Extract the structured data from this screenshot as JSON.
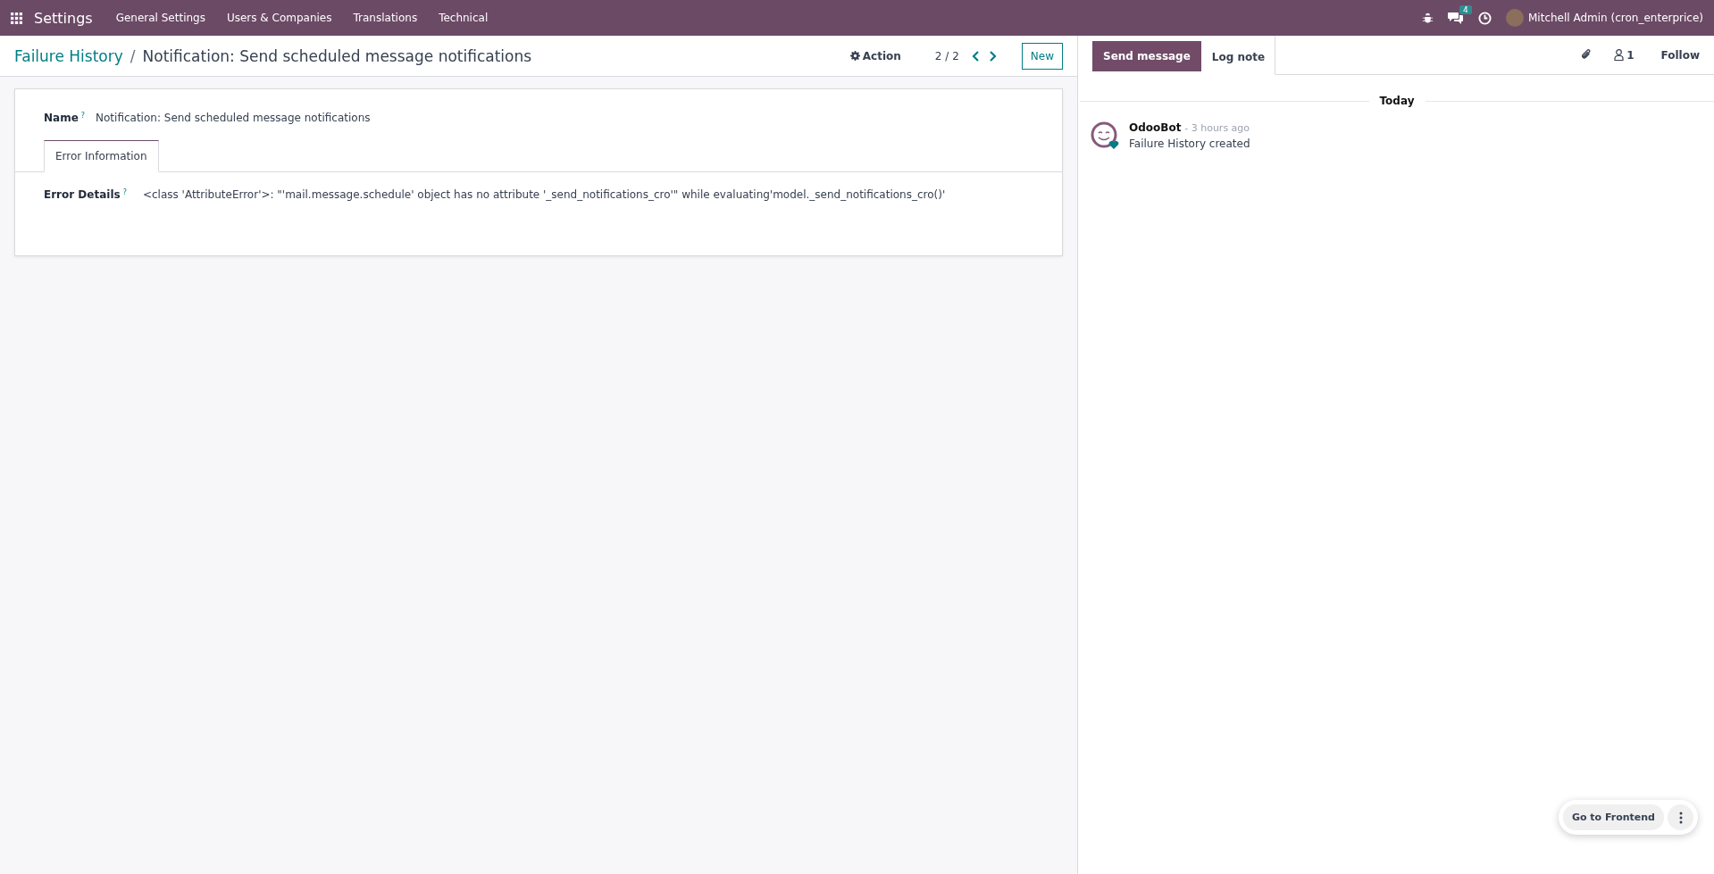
{
  "navbar": {
    "app_name": "Settings",
    "menu": [
      "General Settings",
      "Users & Companies",
      "Translations",
      "Technical"
    ],
    "messages_badge": "4",
    "user": "Mitchell Admin (cron_enterprice)"
  },
  "control_panel": {
    "breadcrumb": "Failure History",
    "separator": "/",
    "title": "Notification: Send scheduled message notifications",
    "action": "Action",
    "pager": "2 / 2",
    "new_button": "New"
  },
  "form": {
    "name_label": "Name",
    "name_help": "?",
    "name_value": "Notification: Send scheduled message notifications",
    "tabs": [
      {
        "label": "Error Information",
        "selected": true
      }
    ],
    "error_label": "Error Details",
    "error_help": "?",
    "error_value": "<class 'AttributeError'>: \"'mail.message.schedule' object has no attribute '_send_notifications_cro'\" while evaluating'model._send_notifications_cro()'"
  },
  "chatter": {
    "tabs": [
      {
        "label": "Send message",
        "selected": true
      },
      {
        "label": "Log note",
        "selected": false
      }
    ],
    "followers": "1",
    "follow": "Follow",
    "date": "Today",
    "messages": [
      {
        "author": "OdooBot",
        "time": "- 3 hours ago",
        "body": "Failure History created"
      }
    ]
  },
  "frontend_button": "Go to Frontend"
}
